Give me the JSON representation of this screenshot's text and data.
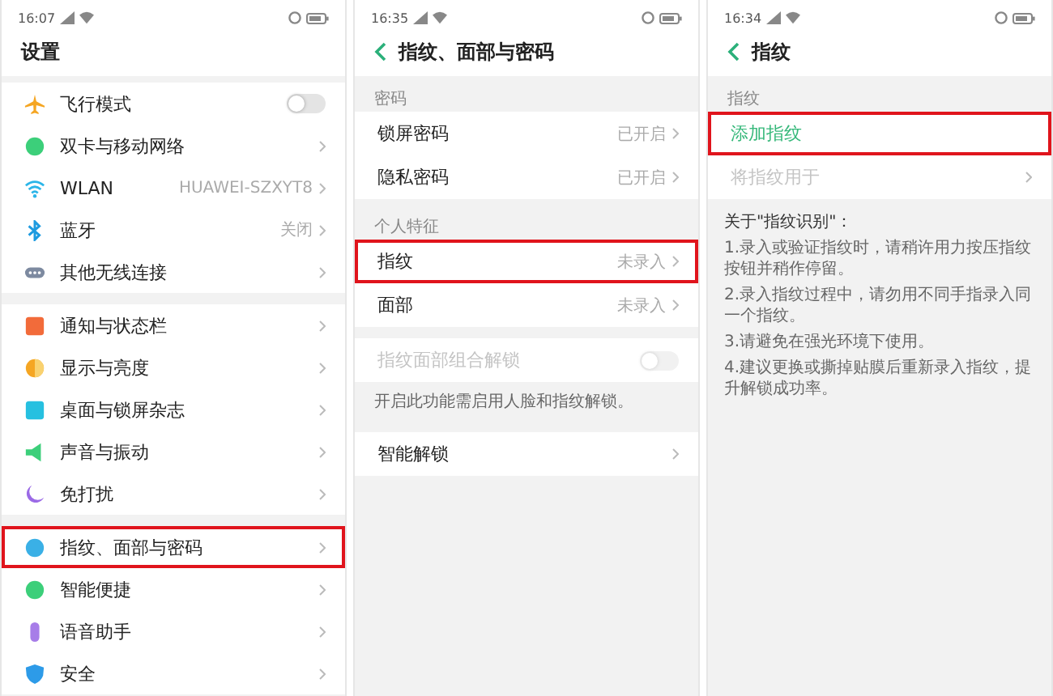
{
  "screens": [
    {
      "time": "16:07",
      "back": false,
      "title": "设置",
      "sections": [
        {
          "items": [
            {
              "kind": "toggle",
              "label": "飞行模式",
              "on": false,
              "disabled": false,
              "highlighted": false
            },
            {
              "kind": "nav",
              "label": "双卡与移动网络",
              "disabled": false,
              "highlighted": false
            },
            {
              "kind": "nav",
              "label": "WLAN",
              "value": "HUAWEI-SZXYT8",
              "disabled": false,
              "highlighted": false
            },
            {
              "kind": "nav",
              "label": "蓝牙",
              "value": "关闭",
              "disabled": false,
              "highlighted": false
            },
            {
              "kind": "nav",
              "label": "其他无线连接",
              "disabled": false,
              "highlighted": false
            }
          ]
        },
        {
          "items": [
            {
              "kind": "nav",
              "label": "通知与状态栏",
              "disabled": false,
              "highlighted": false
            },
            {
              "kind": "nav",
              "label": "显示与亮度",
              "disabled": false,
              "highlighted": false
            },
            {
              "kind": "nav",
              "label": "桌面与锁屏杂志",
              "disabled": false,
              "highlighted": false
            },
            {
              "kind": "nav",
              "label": "声音与振动",
              "disabled": false,
              "highlighted": false
            },
            {
              "kind": "nav",
              "label": "免打扰",
              "disabled": false,
              "highlighted": false
            }
          ]
        },
        {
          "items": [
            {
              "kind": "nav",
              "label": "指纹、面部与密码",
              "disabled": false,
              "highlighted": true
            },
            {
              "kind": "nav",
              "label": "智能便捷",
              "disabled": false,
              "highlighted": false
            },
            {
              "kind": "nav",
              "label": "语音助手",
              "disabled": false,
              "highlighted": false
            },
            {
              "kind": "nav",
              "label": "安全",
              "disabled": false,
              "highlighted": false
            }
          ]
        }
      ]
    },
    {
      "time": "16:35",
      "back": true,
      "title": "指纹、面部与密码",
      "sections": [
        {
          "header": "密码",
          "items": [
            {
              "kind": "nav",
              "label": "锁屏密码",
              "value": "已开启",
              "disabled": false,
              "highlighted": false
            },
            {
              "kind": "nav",
              "label": "隐私密码",
              "value": "已开启",
              "disabled": false,
              "highlighted": false
            }
          ]
        },
        {
          "header": "个人特征",
          "items": [
            {
              "kind": "nav",
              "label": "指纹",
              "value": "未录入",
              "disabled": false,
              "highlighted": true
            },
            {
              "kind": "nav",
              "label": "面部",
              "value": "未录入",
              "disabled": false,
              "highlighted": false
            }
          ]
        },
        {
          "items": [
            {
              "kind": "toggle",
              "label": "指纹面部组合解锁",
              "on": false,
              "disabled": true,
              "highlighted": false
            }
          ],
          "note": "开启此功能需启用人脸和指纹解锁。"
        },
        {
          "items": [
            {
              "kind": "nav",
              "label": "智能解锁",
              "disabled": false,
              "highlighted": false
            }
          ]
        }
      ]
    },
    {
      "time": "16:34",
      "back": true,
      "title": "指纹",
      "sections": [
        {
          "header": "指纹",
          "items": [
            {
              "kind": "action",
              "label": "添加指纹",
              "disabled": false,
              "highlighted": true
            },
            {
              "kind": "nav",
              "label": "将指纹用于",
              "disabled": true,
              "highlighted": false
            }
          ]
        }
      ],
      "about": {
        "title": "关于\"指纹识别\"：",
        "lines": [
          "1.录入或验证指纹时，请稍许用力按压指纹按钮并稍作停留。",
          "2.录入指纹过程中，请勿用不同手指录入同一个指纹。",
          "3.请避免在强光环境下使用。",
          "4.建议更换或撕掉贴膜后重新录入指纹，提升解锁成功率。"
        ]
      }
    }
  ]
}
